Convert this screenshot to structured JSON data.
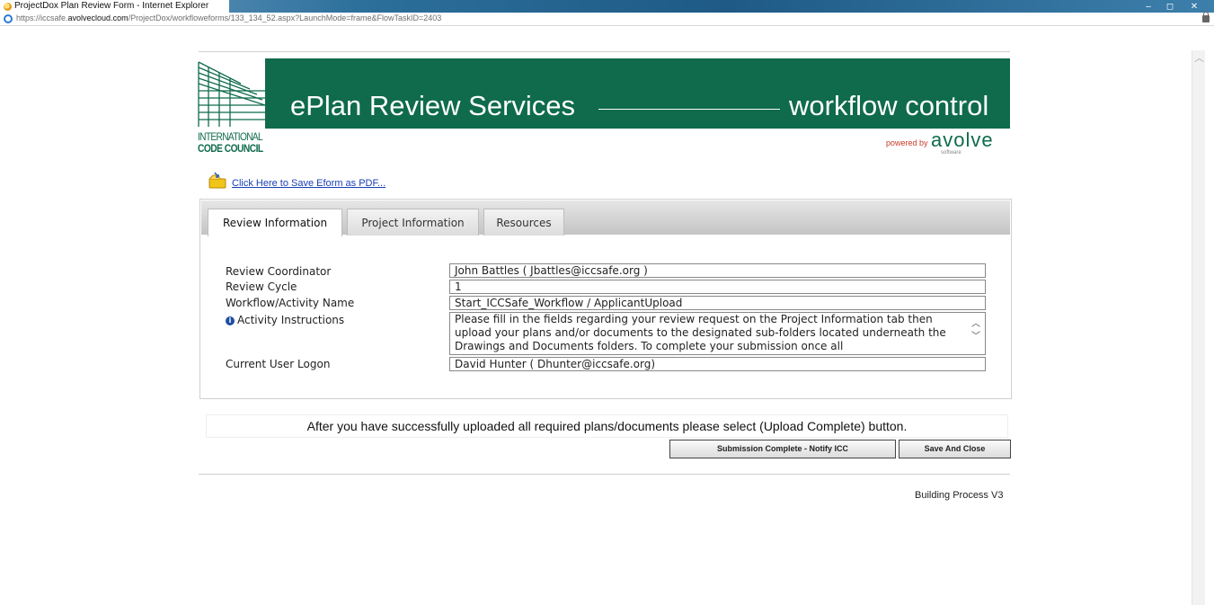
{
  "window": {
    "title": "ProjectDox Plan Review Form - Internet Explorer",
    "url_prefix": "https://iccsafe.",
    "url_host": "avolvecloud.com",
    "url_path": "/ProjectDox/workfloweforms/133_134_52.aspx?LaunchMode=frame&FlowTaskID=2403",
    "controls": {
      "minimize": "–",
      "maximize": "◻",
      "close": "✕"
    }
  },
  "header": {
    "logo_acronym": "ICC",
    "logo_org_line1": "INTERNATIONAL",
    "logo_org_line2": "CODE COUNCIL",
    "title": "ePlan Review Services",
    "subtitle": "workflow control",
    "powered_by": "powered by",
    "vendor": "avolve",
    "vendor_sub": "software",
    "brand_color": "#0f6b4c"
  },
  "pdf_link": "Click Here to Save Eform as PDF...",
  "tabs": [
    {
      "label": "Review Information",
      "active": true
    },
    {
      "label": "Project Information",
      "active": false
    },
    {
      "label": "Resources",
      "active": false
    }
  ],
  "form": {
    "rows": [
      {
        "label": "Review Coordinator",
        "value": "John Battles  ( Jbattles@iccsafe.org )"
      },
      {
        "label": "Review Cycle",
        "value": "1"
      },
      {
        "label": "Workflow/Activity Name",
        "value": "Start_ICCSafe_Workflow / ApplicantUpload"
      },
      {
        "label": "Activity Instructions",
        "value": "Please fill in the fields regarding your review request on the Project Information tab then upload your plans and/or documents to the designated  sub-folders located underneath the Drawings and Documents folders.  To complete your submission once all"
      },
      {
        "label": "Current User Logon",
        "value": "David Hunter ( Dhunter@iccsafe.org)"
      }
    ]
  },
  "message": "After you have successfully uploaded all required plans/documents please select (Upload Complete) button.",
  "buttons": {
    "submit": "Submission Complete - Notify ICC",
    "save": "Save And Close"
  },
  "version": "Building Process V3"
}
